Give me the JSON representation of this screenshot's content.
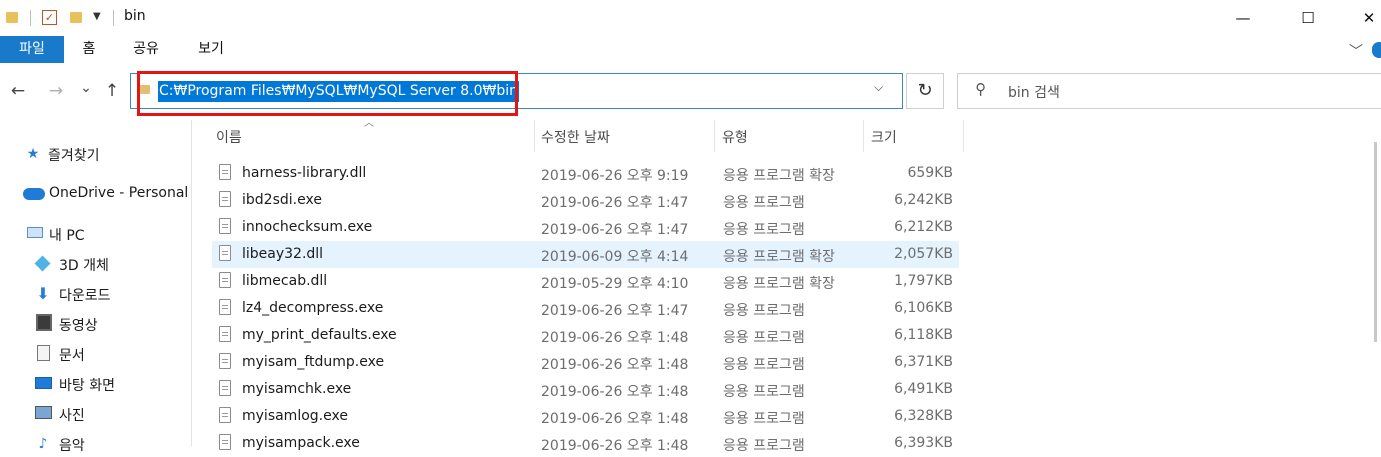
{
  "window": {
    "title": "bin",
    "minimize": "—",
    "maximize": "☐",
    "close": "✕"
  },
  "ribbon": {
    "tabs": [
      "파일",
      "홈",
      "공유",
      "보기"
    ],
    "expand": "﹀"
  },
  "nav": {
    "back": "←",
    "forward": "→",
    "recent": "⌄",
    "up": "↑",
    "address": "C:₩Program Files₩MySQL₩MySQL Server 8.0₩bin",
    "address_dropdown": "⌵",
    "refresh": "↻",
    "search_placeholder": "bin 검색"
  },
  "sidebar": {
    "items": [
      {
        "label": "즐겨찾기",
        "icon": "star-icon"
      },
      {
        "label": "OneDrive - Personal",
        "icon": "cloud-icon"
      },
      {
        "label": "내 PC",
        "icon": "computer-icon"
      },
      {
        "label": "3D 개체",
        "icon": "cube-icon"
      },
      {
        "label": "다운로드",
        "icon": "download-icon"
      },
      {
        "label": "동영상",
        "icon": "film-icon"
      },
      {
        "label": "문서",
        "icon": "document-icon"
      },
      {
        "label": "바탕 화면",
        "icon": "desktop-icon"
      },
      {
        "label": "사진",
        "icon": "picture-icon"
      },
      {
        "label": "음악",
        "icon": "music-icon"
      }
    ]
  },
  "columns": {
    "name": "이름",
    "date": "수정한 날짜",
    "type": "유형",
    "size": "크기"
  },
  "files": [
    {
      "name": "harness-library.dll",
      "date": "2019-06-26 오후 9:19",
      "type": "응용 프로그램 확장",
      "size": "659KB"
    },
    {
      "name": "ibd2sdi.exe",
      "date": "2019-06-26 오후 1:47",
      "type": "응용 프로그램",
      "size": "6,242KB"
    },
    {
      "name": "innochecksum.exe",
      "date": "2019-06-26 오후 1:47",
      "type": "응용 프로그램",
      "size": "6,212KB"
    },
    {
      "name": "libeay32.dll",
      "date": "2019-06-09 오후 4:14",
      "type": "응용 프로그램 확장",
      "size": "2,057KB"
    },
    {
      "name": "libmecab.dll",
      "date": "2019-05-29 오후 4:10",
      "type": "응용 프로그램 확장",
      "size": "1,797KB"
    },
    {
      "name": "lz4_decompress.exe",
      "date": "2019-06-26 오후 1:47",
      "type": "응용 프로그램",
      "size": "6,106KB"
    },
    {
      "name": "my_print_defaults.exe",
      "date": "2019-06-26 오후 1:48",
      "type": "응용 프로그램",
      "size": "6,118KB"
    },
    {
      "name": "myisam_ftdump.exe",
      "date": "2019-06-26 오후 1:48",
      "type": "응용 프로그램",
      "size": "6,371KB"
    },
    {
      "name": "myisamchk.exe",
      "date": "2019-06-26 오후 1:48",
      "type": "응용 프로그램",
      "size": "6,491KB"
    },
    {
      "name": "myisamlog.exe",
      "date": "2019-06-26 오후 1:48",
      "type": "응용 프로그램",
      "size": "6,328KB"
    },
    {
      "name": "myisampack.exe",
      "date": "2019-06-26 오후 1:48",
      "type": "응용 프로그램",
      "size": "6,393KB"
    }
  ],
  "colors": {
    "accent": "#0078d7",
    "file_tab": "#1979ca",
    "highlight_box": "#e51515",
    "selected_row": "#e5f3ff"
  }
}
